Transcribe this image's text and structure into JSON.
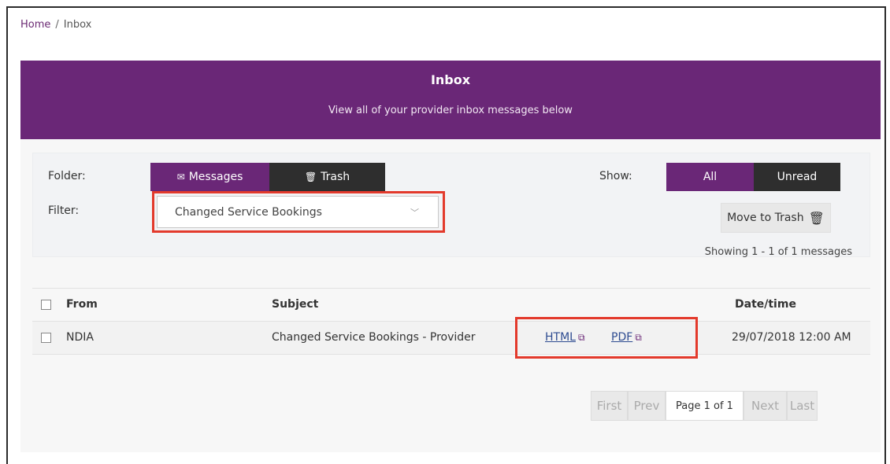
{
  "breadcrumb": {
    "home": "Home",
    "separator": "/",
    "current": "Inbox"
  },
  "header": {
    "title": "Inbox",
    "subtitle": "View all of your provider inbox messages below"
  },
  "filters": {
    "folder_label": "Folder:",
    "folder_options": [
      "Messages",
      "Trash"
    ],
    "folder_selected": "Messages",
    "filter_label": "Filter:",
    "filter_value": "Changed Service Bookings",
    "show_label": "Show:",
    "show_options": [
      "All",
      "Unread"
    ],
    "show_selected": "All",
    "move_to_trash": "Move to Trash",
    "showing_text": "Showing 1 - 1 of 1 messages"
  },
  "table": {
    "headers": {
      "from": "From",
      "subject": "Subject",
      "datetime": "Date/time"
    },
    "rows": [
      {
        "from": "NDIA",
        "subject": "Changed Service Bookings - Provider",
        "html": "HTML",
        "pdf": "PDF",
        "datetime": "29/07/2018 12:00 AM"
      }
    ]
  },
  "pager": {
    "first": "First",
    "prev": "Prev",
    "page": "Page 1 of 1",
    "next": "Next",
    "last": "Last"
  },
  "icons": {
    "messages": "envelope-icon",
    "trash": "trash-icon",
    "external": "external-link-icon",
    "chevron": "chevron-down-icon"
  },
  "colors": {
    "brand": "#6a2777",
    "dark": "#2e2e2e",
    "highlight": "#e33a2c",
    "link": "#2e4c91"
  }
}
